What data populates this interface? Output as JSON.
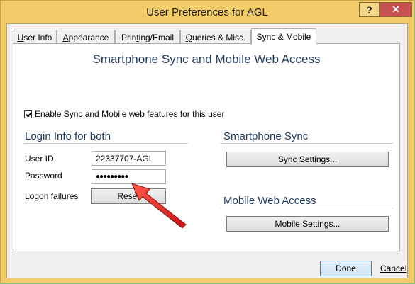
{
  "window": {
    "title": "User Preferences for AGL",
    "help_glyph": "?",
    "close_glyph": "✕"
  },
  "tabs": [
    {
      "label": "User Info",
      "underline": "U",
      "rest": "ser Info"
    },
    {
      "label": "Appearance",
      "underline": "A",
      "rest": "ppearance"
    },
    {
      "label": "Printing/Email",
      "underline": "t",
      "pre": "Prin",
      "rest": "ing/Email"
    },
    {
      "label": "Queries & Misc.",
      "underline": "Q",
      "rest": "ueries & Misc."
    },
    {
      "label": "Sync & Mobile",
      "active": true
    }
  ],
  "panel": {
    "heading": "Smartphone Sync and Mobile Web Access",
    "enable_checkbox": {
      "label": "Enable Sync and Mobile web features for this user",
      "checked": true
    },
    "login": {
      "title": "Login Info for both",
      "user_id_label": "User ID",
      "user_id_value": "22337707-AGL",
      "password_label": "Password",
      "password_value": "●●●●●●●●●",
      "logon_failures_label": "Logon failures",
      "reset_label": "Reset"
    },
    "sync": {
      "title": "Smartphone Sync",
      "button_label": "Sync Settings..."
    },
    "mobile": {
      "title": "Mobile Web Access",
      "button_label": "Mobile Settings..."
    }
  },
  "footer": {
    "done_label": "Done",
    "cancel_label": "Cancel"
  },
  "colors": {
    "title_bar": "#f3cc6a",
    "close": "#c75050",
    "heading_text": "#1e3a5f",
    "arrow": "#e02020"
  }
}
